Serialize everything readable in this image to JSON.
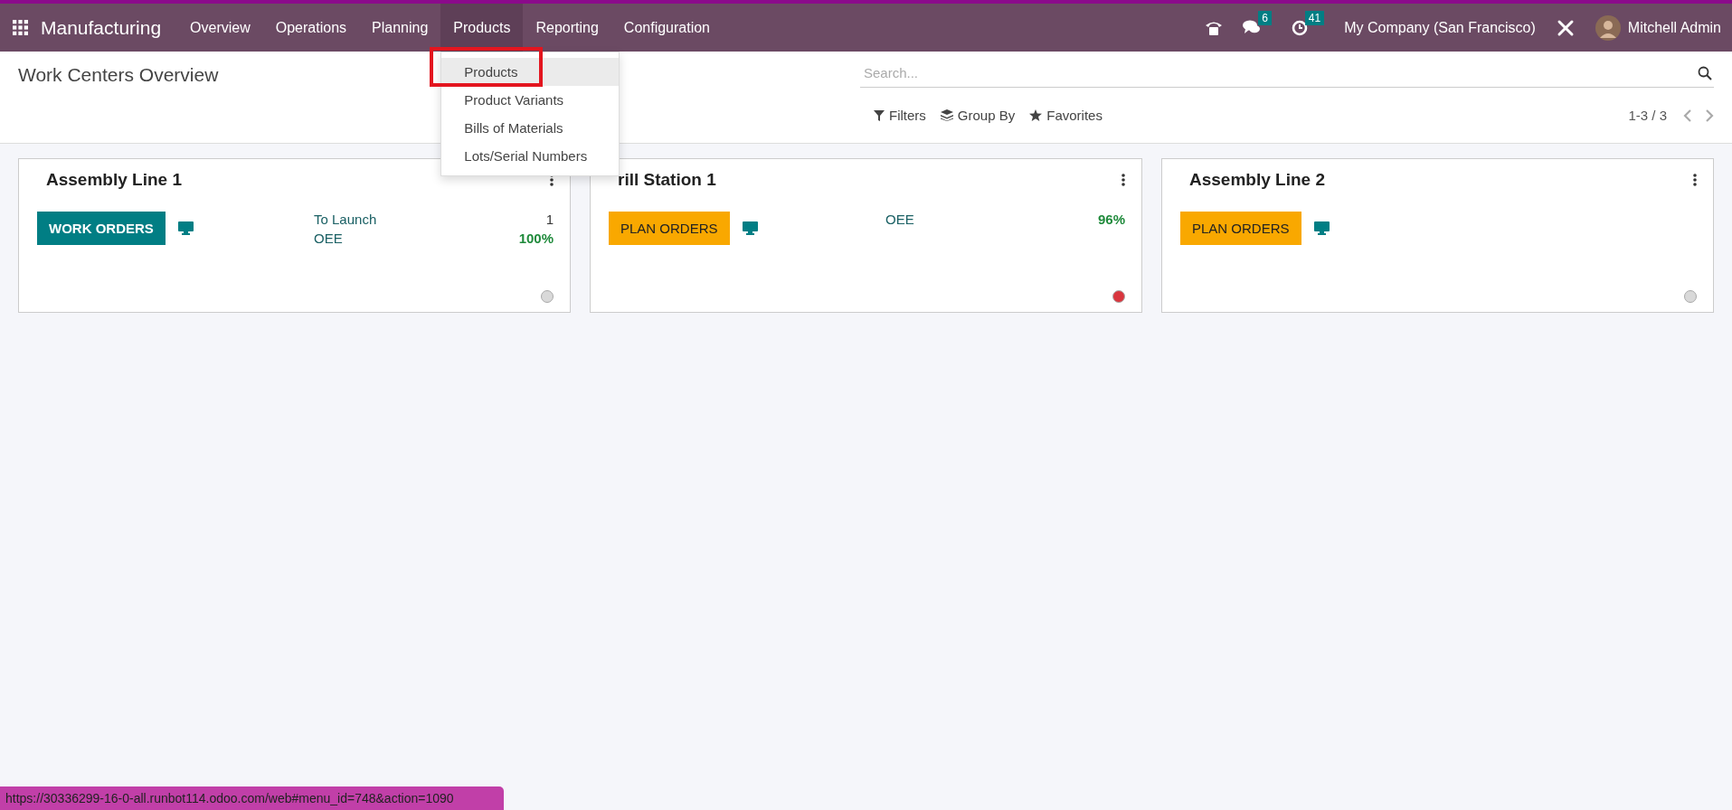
{
  "navbar": {
    "app_name": "Manufacturing",
    "menu": [
      {
        "label": "Overview",
        "selected": false
      },
      {
        "label": "Operations",
        "selected": false
      },
      {
        "label": "Planning",
        "selected": false
      },
      {
        "label": "Products",
        "selected": true
      },
      {
        "label": "Reporting",
        "selected": false
      },
      {
        "label": "Configuration",
        "selected": false
      }
    ],
    "messages_count": "6",
    "activities_count": "41",
    "company": "My Company (San Francisco)",
    "user": "Mitchell Admin"
  },
  "dropdown": {
    "items": [
      {
        "label": "Products",
        "selected": true
      },
      {
        "label": "Product Variants",
        "selected": false
      },
      {
        "label": "Bills of Materials",
        "selected": false
      },
      {
        "label": "Lots/Serial Numbers",
        "selected": false
      }
    ]
  },
  "control_panel": {
    "title": "Work Centers Overview",
    "search": {
      "placeholder": "Search..."
    },
    "filters": "Filters",
    "group_by": "Group By",
    "favorites": "Favorites",
    "pager": "1-3 / 3"
  },
  "cards": [
    {
      "title": "Assembly Line 1",
      "button": {
        "kind": "work",
        "label": "WORK ORDERS"
      },
      "stats": [
        {
          "label": "To Launch",
          "value": "1",
          "kind": "count"
        },
        {
          "label": "OEE",
          "value": "100%",
          "kind": "percent"
        }
      ],
      "color": "#d9d9d9"
    },
    {
      "title": "rill Station 1",
      "button": {
        "kind": "plan",
        "label": "PLAN ORDERS"
      },
      "stats": [
        {
          "label": "OEE",
          "value": "96%",
          "kind": "percent"
        }
      ],
      "color": "#d9363e"
    },
    {
      "title": "Assembly Line 2",
      "button": {
        "kind": "plan",
        "label": "PLAN ORDERS"
      },
      "color": "#d9d9d9"
    }
  ],
  "status_bar": {
    "url": "https://30336299-16-0-all.runbot114.odoo.com/web#menu_id=748&action=1090"
  }
}
